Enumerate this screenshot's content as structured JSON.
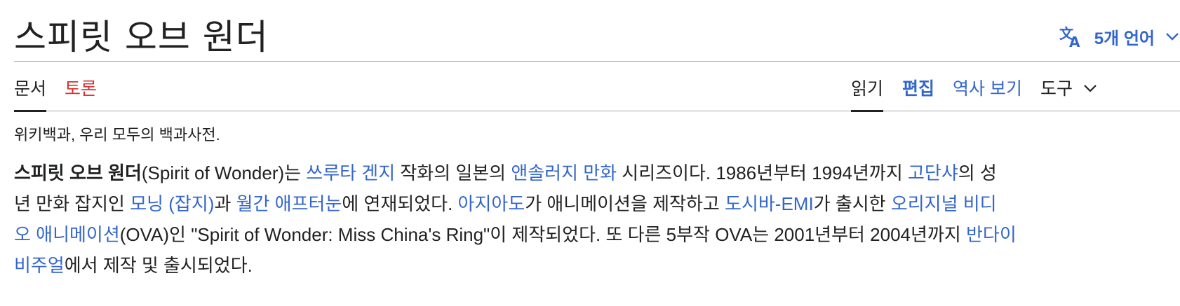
{
  "header": {
    "title": "스피릿 오브 원더",
    "language_button": "5개 언어",
    "language_icon": "translate-icon",
    "chevron_icon": "chevron-down-icon"
  },
  "tabs": {
    "left": [
      {
        "label": "문서",
        "state": "selected"
      },
      {
        "label": "토론",
        "state": "red-link"
      }
    ],
    "right": [
      {
        "label": "읽기",
        "state": "selected"
      },
      {
        "label": "편집",
        "state": "bold-link"
      },
      {
        "label": "역사 보기",
        "state": "link"
      },
      {
        "label": "도구",
        "state": "dropdown"
      }
    ]
  },
  "tagline": "위키백과, 우리 모두의 백과사전.",
  "article": {
    "lines": [
      [
        {
          "t": "스피릿 오브 원더",
          "k": "bold"
        },
        {
          "t": "(Spirit of Wonder)는 ",
          "k": "text"
        },
        {
          "t": "쓰루타 겐지",
          "k": "link"
        },
        {
          "t": " 작화의 일본의 ",
          "k": "text"
        },
        {
          "t": "앤솔러지 만화",
          "k": "link"
        },
        {
          "t": " 시리즈이다. 1986년부터 1994년까지 ",
          "k": "text"
        },
        {
          "t": "고단샤",
          "k": "link"
        },
        {
          "t": "의 성",
          "k": "text"
        }
      ],
      [
        {
          "t": "년 만화 잡지인 ",
          "k": "text"
        },
        {
          "t": "모닝 (잡지)",
          "k": "link"
        },
        {
          "t": "과 ",
          "k": "text"
        },
        {
          "t": "월간 애프터눈",
          "k": "link"
        },
        {
          "t": "에 연재되었다. ",
          "k": "text"
        },
        {
          "t": "아지아도",
          "k": "link"
        },
        {
          "t": "가 애니메이션을 제작하고 ",
          "k": "text"
        },
        {
          "t": "도시바-EMI",
          "k": "link"
        },
        {
          "t": "가 출시한 ",
          "k": "text"
        },
        {
          "t": "오리지널 비디",
          "k": "link"
        }
      ],
      [
        {
          "t": "오 애니메이션",
          "k": "link"
        },
        {
          "t": "(OVA)인 \"Spirit of Wonder: Miss China's Ring\"이 제작되었다. 또 다른 5부작 OVA는 2001년부터 2004년까지 ",
          "k": "text"
        },
        {
          "t": "반다이",
          "k": "link"
        }
      ],
      [
        {
          "t": "비주얼",
          "k": "link"
        },
        {
          "t": "에서 제작 및 출시되었다.",
          "k": "text"
        }
      ]
    ]
  }
}
